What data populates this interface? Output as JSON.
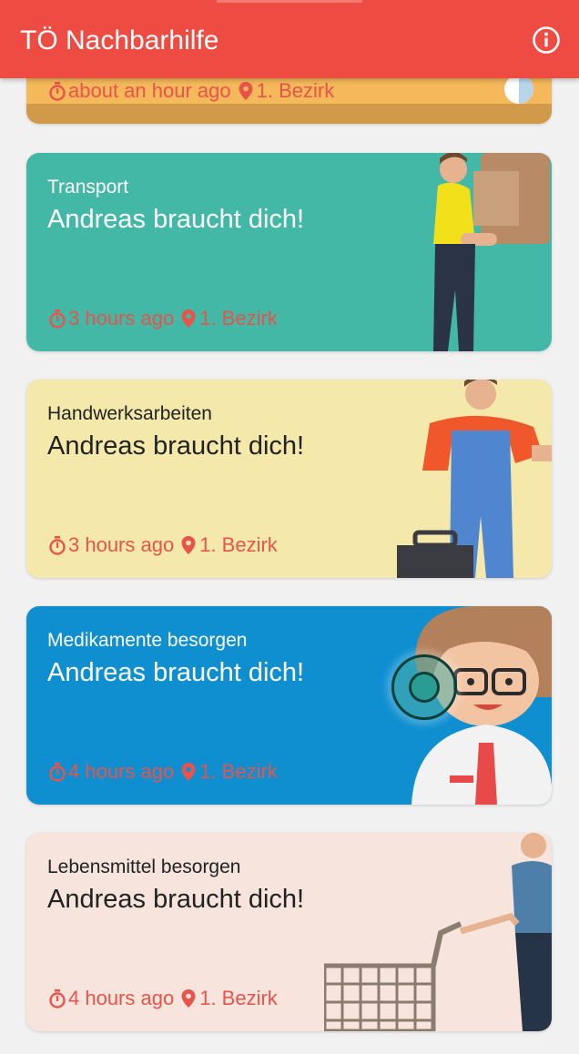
{
  "app": {
    "title": "TÖ Nachbarhilfe",
    "accent": "#ee4b42",
    "info_icon": "info-icon"
  },
  "cards": [
    {
      "time": "about an hour ago",
      "district": "1. Bezirk",
      "color": "#f5b85a"
    },
    {
      "category": "Transport",
      "headline": "Andreas braucht dich!",
      "time": "3 hours ago",
      "district": "1. Bezirk",
      "color": "#44b8a6"
    },
    {
      "category": "Handwerksarbeiten",
      "headline": "Andreas braucht dich!",
      "time": "3 hours ago",
      "district": "1. Bezirk",
      "color": "#f4e9aa"
    },
    {
      "category": "Medikamente besorgen",
      "headline": "Andreas braucht dich!",
      "time": "4 hours ago",
      "district": "1. Bezirk",
      "color": "#0f8fd0"
    },
    {
      "category": "Lebensmittel besorgen",
      "headline": "Andreas braucht dich!",
      "time": "4 hours ago",
      "district": "1. Bezirk",
      "color": "#f6e4dd"
    }
  ],
  "icons": {
    "time": "stopwatch-icon",
    "location": "location-pin-icon"
  }
}
